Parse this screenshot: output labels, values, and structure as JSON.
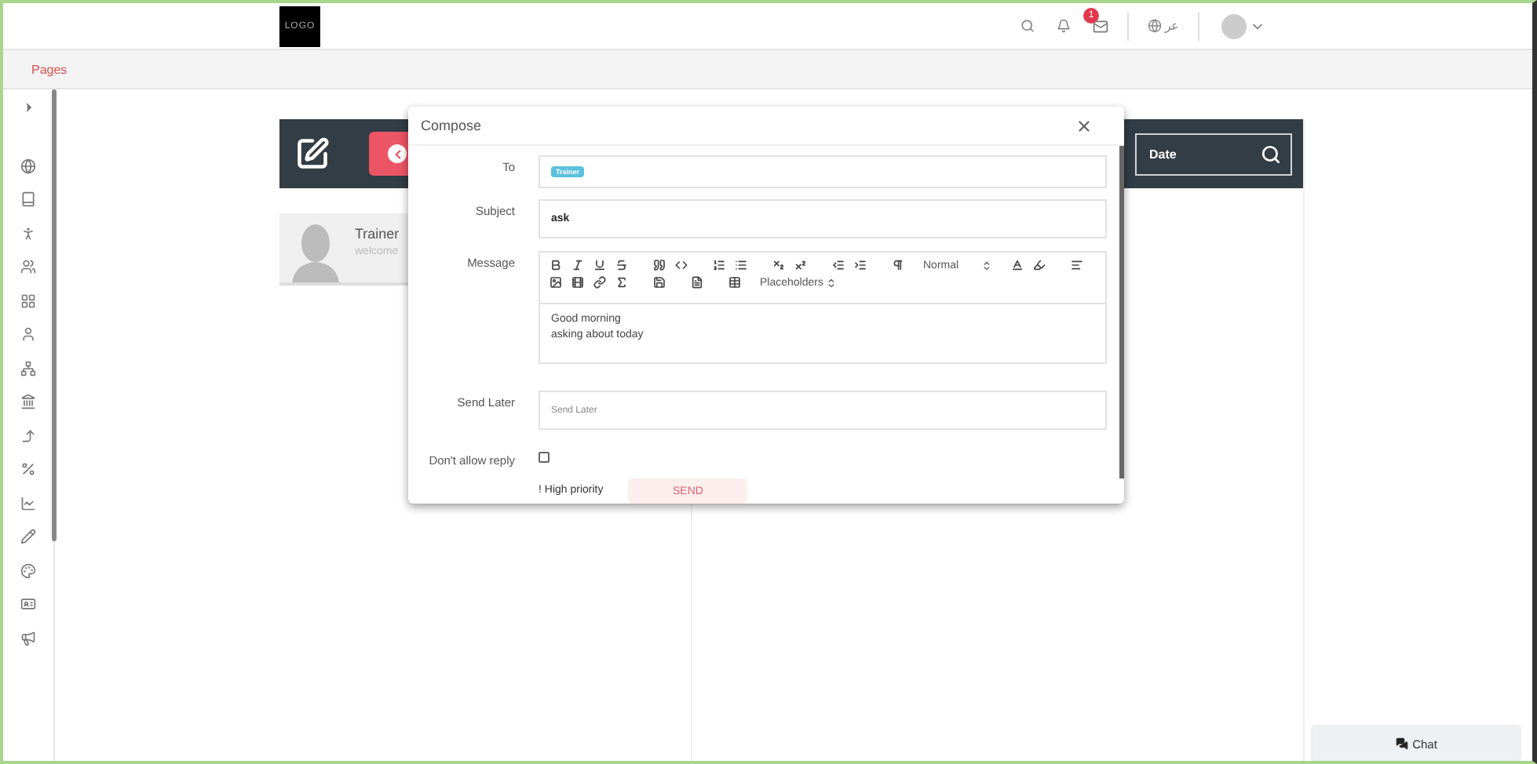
{
  "header": {
    "logo": "LOGO",
    "mail_badge": "1",
    "language": "عر"
  },
  "breadcrumb": "Pages",
  "toolbar": {
    "date_placeholder": "Date"
  },
  "conversations": [
    {
      "name": "Trainer",
      "preview": "welcome",
      "selected": true
    }
  ],
  "compose": {
    "title": "Compose",
    "to_label": "To",
    "recipients": [
      "Trainer"
    ],
    "subject_label": "Subject",
    "subject": "ask",
    "message_label": "Message",
    "format": "Normal",
    "placeholders": "Placeholders",
    "message_lines": [
      "Good morning",
      "asking about today"
    ],
    "send_later_label": "Send Later",
    "send_later_placeholder": "Send Later",
    "no_reply_label": "Don't allow reply",
    "no_reply_checked": false,
    "high_priority": "! High priority",
    "send": "SEND"
  },
  "chat": "Chat"
}
